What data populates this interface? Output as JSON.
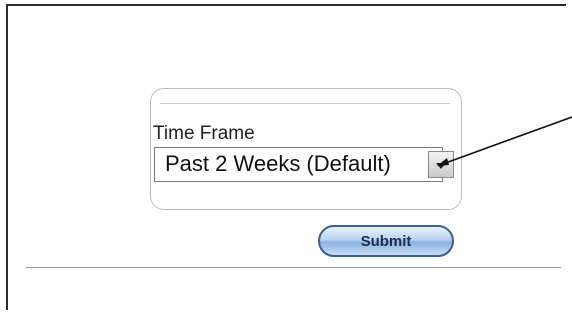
{
  "form": {
    "time_frame_label": "Time Frame",
    "time_frame_selected": "Past 2 Weeks (Default)",
    "submit_label": "Submit"
  },
  "colors": {
    "submit_border": "#3c5f8f",
    "submit_fill": "#b9d3f2"
  }
}
